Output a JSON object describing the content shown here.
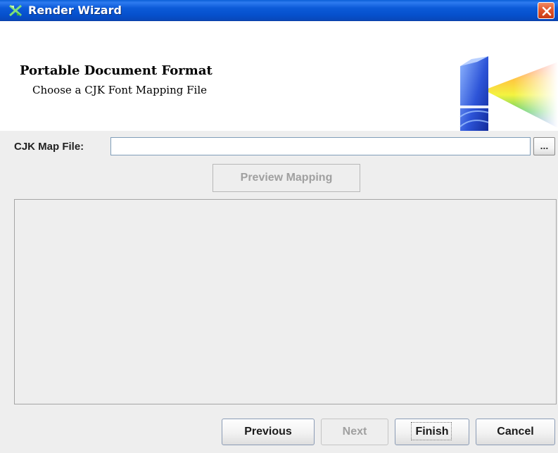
{
  "window": {
    "title": "Render Wizard",
    "icons": {
      "app": "render-wizard-icon",
      "close": "close-icon"
    }
  },
  "header": {
    "title": "Portable Document Format",
    "subtitle": "Choose a CJK Font Mapping File",
    "image": "prism-icon"
  },
  "form": {
    "map_file_label": "CJK Map File:",
    "map_file_value": "",
    "browse_label": "...",
    "preview_label": "Preview Mapping"
  },
  "buttons": {
    "previous": "Previous",
    "next": "Next",
    "finish": "Finish",
    "cancel": "Cancel"
  },
  "colors": {
    "titlebar": "#0650cc",
    "close": "#e2562c",
    "panel": "#eeeeee",
    "disabled_text": "#a0a0a0"
  }
}
